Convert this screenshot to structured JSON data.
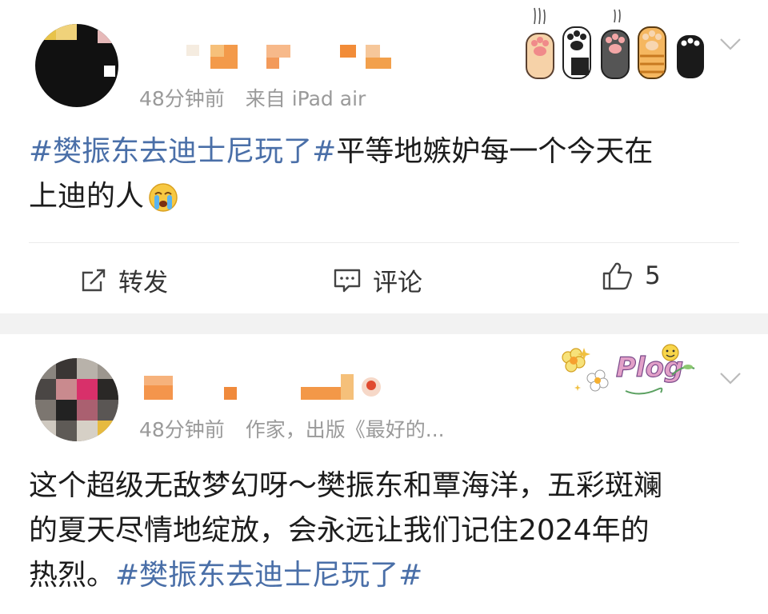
{
  "post1": {
    "meta_time": "48分钟前",
    "meta_source": "来自 iPad air",
    "text_line1_hashtag": "#樊振东去迪士尼玩了#",
    "text_line1_rest": "平等地嫉妒每一个今天在",
    "text_line2": "上迪的人",
    "emoji": "crying-emoji",
    "actions": {
      "repost_label": "转发",
      "comment_label": "评论",
      "like_count": "5"
    }
  },
  "post2": {
    "meta_time": "48分钟前",
    "meta_source": "作家，出版《最好的...",
    "text_line1": "这个超级无敌梦幻呀～樊振东和覃海洋，五彩斑斓",
    "text_line2": "的夏天尽情地绽放，会永远让我们记住2024年的",
    "text_line3_prefix": "热烈。",
    "text_line3_hashtag": "#樊振东去迪士尼玩了#"
  },
  "decor": {
    "plog_text": "Plog",
    "hashtag_color": "#4a6fa8",
    "meta_color": "#9a9a9a"
  }
}
